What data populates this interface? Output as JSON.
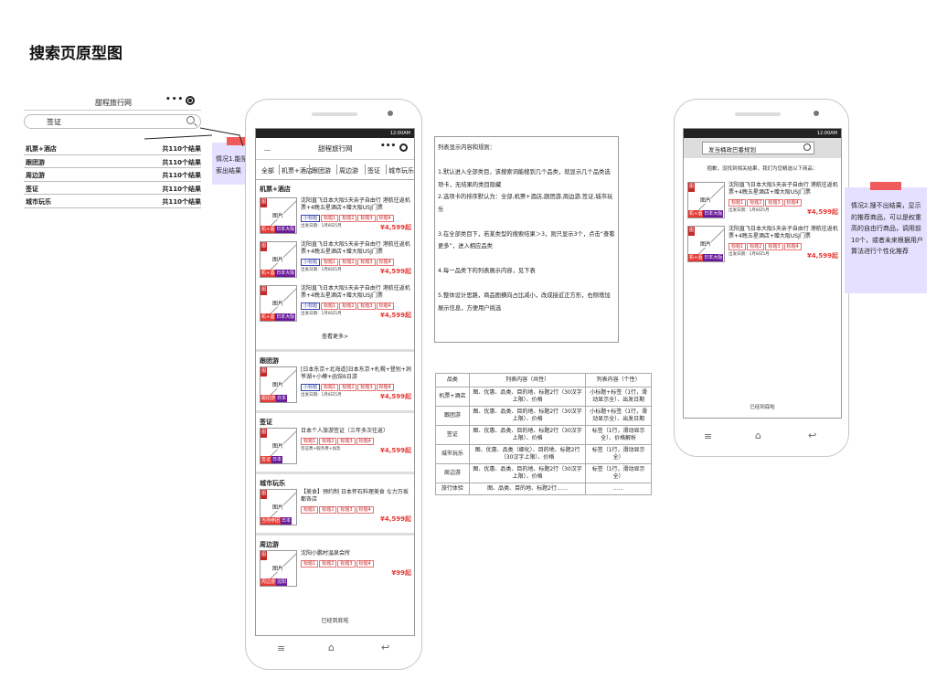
{
  "page_title": "搜索页原型图",
  "mini": {
    "app_title": "甜程旅行网",
    "menu_dots": "•••",
    "search_value": "签证",
    "rows": [
      {
        "name": "机票+酒店",
        "count": "共110个结果"
      },
      {
        "name": "跟团游",
        "count": "共110个结果"
      },
      {
        "name": "周边游",
        "count": "共110个结果"
      },
      {
        "name": "签证",
        "count": "共110个结果"
      },
      {
        "name": "城市玩乐",
        "count": "共110个结果"
      }
    ]
  },
  "note1": {
    "text": "情况1.能搜索出结果"
  },
  "note2": {
    "text": "情况2.搜不出结果，显示的推荐商品，可以是权重高的自由行商品，调用前10个，或者未来根据用户算法进行个性化推荐"
  },
  "phone1": {
    "status": "12:00AM",
    "back": "﹏",
    "app_title": "甜程旅行网",
    "menu_dots": "•••",
    "tabs": [
      "全部",
      "机票+酒店",
      "跟团游",
      "周边游",
      "签证",
      "城市玩乐"
    ],
    "pic_label": "图片",
    "pic_badge": "图",
    "sections": [
      {
        "title": "机票+酒店",
        "items": [
          {
            "title": "沈阳直飞日本大阪5天亲子自由行 港航往返机票+4晚五星酒店+赠大阪USJ门票",
            "tags": [
              "小标题",
              "标题1",
              "标题2",
              "标题3",
              "标题4"
            ],
            "meta": "出发日期：1月8日5月",
            "price": "¥4,599起",
            "bar": [
              "机+酒",
              "日本大阪"
            ]
          },
          {
            "title": "沈阳直飞日本大阪5天亲子自由行 港航往返机票+4晚五星酒店+赠大阪USJ门票",
            "tags": [
              "小标题",
              "标题1",
              "标题2",
              "标题3",
              "标题4"
            ],
            "meta": "出发日期：1月8日5月",
            "price": "¥4,599起",
            "bar": [
              "机+酒",
              "日本大阪"
            ]
          },
          {
            "title": "沈阳直飞日本大阪5天亲子自由行 港航往返机票+4晚五星酒店+赠大阪USJ门票",
            "tags": [
              "小标题",
              "标题1",
              "标题2",
              "标题3",
              "标题4"
            ],
            "meta": "出发日期：1月8日5月",
            "price": "¥4,599起",
            "bar": [
              "机+酒",
              "日本大阪"
            ]
          }
        ],
        "more": "查看更多>"
      },
      {
        "title": "跟团游",
        "items": [
          {
            "title": "[日本东京+北海道]日本东京+札幌+登别+洞爷湖+小樽+函馆6日游",
            "tags": [
              "小标题",
              "标题1",
              "标题2",
              "标题3",
              "标题4"
            ],
            "meta": "出发日期：1月8日5月",
            "price": "¥4,599起",
            "bar": [
              "跟团游",
              "日本"
            ]
          }
        ]
      },
      {
        "title": "签证",
        "items": [
          {
            "title": "日本个人旅游签证（三年多次往返）",
            "tags": [
              "标题1",
              "标题2",
              "标题3",
              "标题4"
            ],
            "meta": "签证费+服务费+加急",
            "price": "¥4,599起",
            "bar": [
              "签证",
              "日本"
            ]
          }
        ]
      },
      {
        "title": "城市玩乐",
        "items": [
          {
            "title": "【美食】预约制 日本怀石料理美食 な力万坂都各店",
            "tags": [
              "标题1",
              "标题2",
              "标题3",
              "标题4"
            ],
            "meta": "",
            "price": "¥4,599起",
            "bar": [
              "当地参团",
              "日本"
            ]
          }
        ]
      },
      {
        "title": "周边游",
        "items": [
          {
            "title": "沈阳小鹏村温泉会所",
            "tags": [
              "标题1",
              "标题2",
              "标题3",
              "标题4"
            ],
            "meta": "",
            "price": "¥99起",
            "bar": [
              "周边游",
              "沈阳"
            ]
          }
        ]
      }
    ],
    "end_text": "已经到底啦",
    "nav": [
      "≡",
      "⌂",
      "↩"
    ]
  },
  "rules": {
    "lines": [
      "列表显示内容和规则：",
      "",
      "1.默认进入全部类目，该搜索词能搜到几个品类，就显示几个品类选项卡，无结果的类目隐藏",
      "2.选项卡的排序默认为：全部,机票+酒店,跟团游,周边游,签证,城市玩乐",
      "",
      "3.在全部类目下，若某类型的搜索结果＞3，则只显示3个，点击“查看更多”，进入相应品类",
      "",
      "4.每一品类下的列表展示内容，见下表",
      "",
      "5.整体设计思路，商品图横向占比减小，改成接近正方形，右侧增加展示信息，方便用户挑选"
    ]
  },
  "table": {
    "headers": [
      "品类",
      "列表内容（共性）",
      "列表内容（个性）"
    ],
    "rows": [
      [
        "机票+酒店",
        "图、优惠、品类、目的地、标题2行（30汉字上限）、价格",
        "小标题+标签（1行，滑动显示全）、出发日期"
      ],
      [
        "跟团游",
        "图、优惠、品类、目的地、标题2行（30汉字上限）、价格",
        "小标题+标签（1行，滑动显示全）、出发日期"
      ],
      [
        "签证",
        "图、优惠、品类、目的地、标题2行（30汉字上限）、价格",
        "标签（1行，滑动显示全）、价格解析"
      ],
      [
        "城市玩乐",
        "图、优惠、品类（细化）、目的地、标题2行（30汉字上限）、价格",
        "标签（1行，滑动显示全）"
      ],
      [
        "周边游",
        "图、优惠、品类、目的地、标题2行（30汉字上限）、价格",
        "标签（1行，滑动显示全）"
      ],
      [
        "旅行体验",
        "图、品类、目的地、标题2行……",
        "……"
      ]
    ]
  },
  "phone2": {
    "status": "12:00AM",
    "search_value": "发当桶政巴番规划",
    "tip": "抱歉，没找到相关结果，我们为您精选以下商品：",
    "items": [
      {
        "title": "沈阳直飞日本大阪5天亲子自由行 港航往返机票+4晚五星酒店+赠大阪USJ门票",
        "tags": [
          "标题1",
          "标题2",
          "标题3",
          "标题4"
        ],
        "meta": "出发日期：1月8日5月",
        "price": "¥4,599起",
        "bar": [
          "机+酒",
          "日本大阪"
        ]
      },
      {
        "title": "沈阳直飞日本大阪5天亲子自由行 港航往返机票+4晚五星酒店+赠大阪USJ门票",
        "tags": [
          "标题1",
          "标题2",
          "标题3",
          "标题4"
        ],
        "meta": "出发日期：1月8日5月",
        "price": "¥4,599起",
        "bar": [
          "机+酒",
          "日本大阪"
        ]
      }
    ],
    "end_text": "已经到底啦",
    "nav": [
      "≡",
      "⌂",
      "↩"
    ]
  }
}
